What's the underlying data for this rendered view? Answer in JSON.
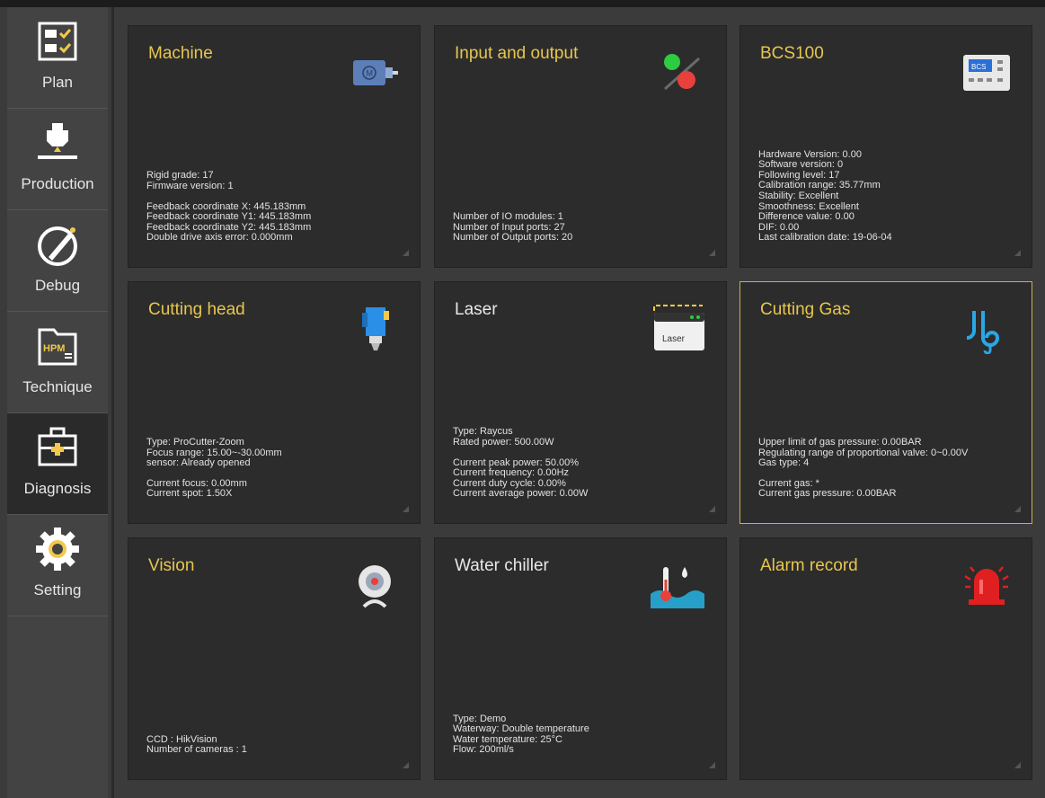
{
  "sidebar": {
    "items": [
      {
        "label": "Plan",
        "icon": "plan-checklist-icon"
      },
      {
        "label": "Production",
        "icon": "production-icon"
      },
      {
        "label": "Debug",
        "icon": "debug-pen-icon"
      },
      {
        "label": "Technique",
        "icon": "hpm-folder-icon"
      },
      {
        "label": "Diagnosis",
        "icon": "medical-kit-icon",
        "active": true
      },
      {
        "label": "Setting",
        "icon": "gear-icon"
      }
    ]
  },
  "cards": {
    "machine": {
      "title": "Machine",
      "icon": "motor-icon",
      "lines": [
        "Rigid grade: 17",
        "Firmware version: 1",
        "",
        "Feedback coordinate X: 445.183mm",
        "Feedback coordinate Y1: 445.183mm",
        "Feedback coordinate Y2: 445.183mm",
        "Double drive axis error: 0.000mm"
      ]
    },
    "io": {
      "title": "Input and output",
      "icon": "io-switch-icon",
      "lines": [
        "Number of IO modules: 1",
        "Number of Input ports: 27",
        "Number of Output ports: 20"
      ]
    },
    "bcs100": {
      "title": "BCS100",
      "icon": "bcs-controller-icon",
      "icon_text": "BCS",
      "lines": [
        "Hardware Version: 0.00",
        "Software version: 0",
        "Following level: 17",
        "Calibration range: 35.77mm",
        "Stability: Excellent",
        "Smoothness: Excellent",
        "Difference value: 0.00",
        "DIF: 0.00",
        "Last calibration date: 19-06-04"
      ]
    },
    "cutting_head": {
      "title": "Cutting head",
      "icon": "cutting-head-icon",
      "lines": [
        "Type: ProCutter-Zoom",
        "Focus range: 15.00~-30.00mm",
        "sensor: Already opened",
        "",
        "Current focus: 0.00mm",
        "Current spot: 1.50X"
      ]
    },
    "laser": {
      "title": "Laser",
      "icon": "laser-device-icon",
      "icon_text": "Laser",
      "lines": [
        "Type: Raycus",
        "Rated power: 500.00W",
        "",
        "Current peak power: 50.00%",
        "Current frequency: 0.00Hz",
        "Current duty cycle: 0.00%",
        "Current average power: 0.00W"
      ]
    },
    "cutting_gas": {
      "title": "Cutting Gas",
      "icon": "gas-pipe-icon",
      "lines": [
        "Upper limit of gas pressure: 0.00BAR",
        "Regulating range of proportional valve: 0~0.00V",
        "Gas type: 4",
        "",
        "Current gas: *",
        "Current gas pressure: 0.00BAR"
      ]
    },
    "vision": {
      "title": "Vision",
      "icon": "camera-icon",
      "lines": [
        "CCD : HikVision",
        "Number of cameras : 1"
      ]
    },
    "water_chiller": {
      "title": "Water chiller",
      "icon": "water-thermometer-icon",
      "lines": [
        "Type: Demo",
        "Waterway: Double temperature",
        "Water temperature: 25°C",
        "Flow: 200ml/s"
      ]
    },
    "alarm_record": {
      "title": "Alarm record",
      "icon": "alarm-siren-icon",
      "lines": []
    }
  },
  "colors": {
    "title_accent": "#e7c64e",
    "card_bg": "#2c2c2c",
    "active_border": "#c9b24c",
    "sidebar_bg": "#434343"
  }
}
